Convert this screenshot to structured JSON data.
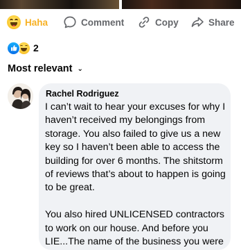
{
  "actions": {
    "haha_label": "Haha",
    "comment_label": "Comment",
    "copy_label": "Copy",
    "share_label": "Share",
    "haha_color": "#f7b125",
    "muted_color": "#65676b"
  },
  "reactions": {
    "types": [
      "like-icon",
      "haha-icon"
    ],
    "count": "2"
  },
  "sort": {
    "label": "Most relevant",
    "chevron": "⌄"
  },
  "comment": {
    "author": "Rachel Rodriguez",
    "text": "I can’t wait to hear your excuses for why I haven’t received my belongings from storage. You also failed to give us a new key so I haven’t been able to access the building for over 6 months. The shitstorm of reviews that’s about to happen is going to be great.\n\nYou also hired UNLICENSED contractors to work on our house. And before you LIE...The name of the business you were"
  }
}
